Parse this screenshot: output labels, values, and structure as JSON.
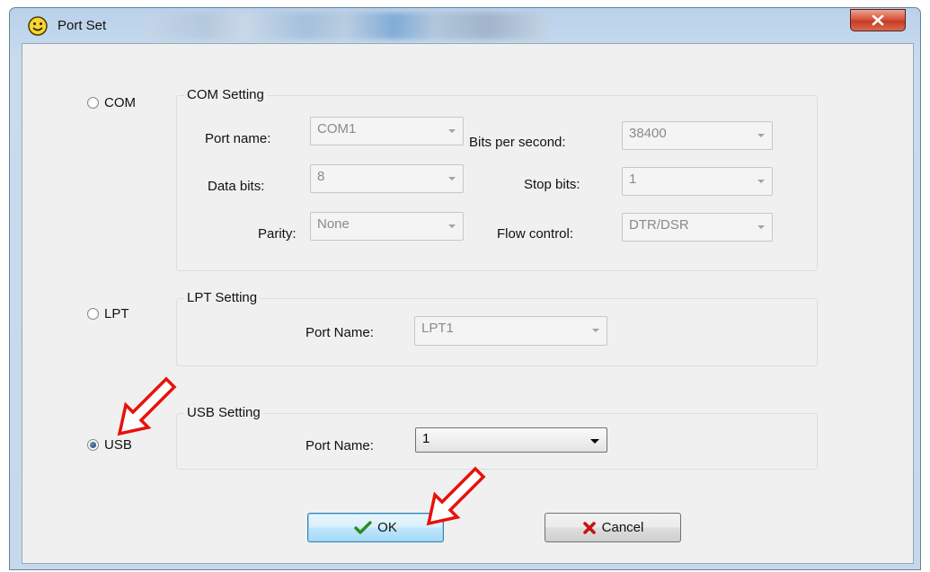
{
  "window": {
    "title": "Port Set"
  },
  "com": {
    "radio_label": "COM",
    "selected": false,
    "group_title": "COM Setting",
    "port_name_label": "Port name:",
    "port_name_value": "COM1",
    "bits_label": "Bits per second:",
    "bits_value": "38400",
    "data_bits_label": "Data bits:",
    "data_bits_value": "8",
    "stop_bits_label": "Stop bits:",
    "stop_bits_value": "1",
    "parity_label": "Parity:",
    "parity_value": "None",
    "flow_label": "Flow control:",
    "flow_value": "DTR/DSR"
  },
  "lpt": {
    "radio_label": "LPT",
    "selected": false,
    "group_title": "LPT Setting",
    "port_name_label": "Port Name:",
    "port_name_value": "LPT1"
  },
  "usb": {
    "radio_label": "USB",
    "selected": true,
    "group_title": "USB Setting",
    "port_name_label": "Port Name:",
    "port_name_value": "1"
  },
  "buttons": {
    "ok_label": "OK",
    "cancel_label": "Cancel"
  },
  "colors": {
    "annotation_arrow": "#e8120c",
    "close_button": "#c9452c",
    "ok_check": "#2e8b1e",
    "cancel_x": "#c4160e"
  },
  "icons": {
    "app": "smiley-icon",
    "close": "close-icon",
    "ok": "checkmark-icon",
    "cancel": "x-icon"
  }
}
